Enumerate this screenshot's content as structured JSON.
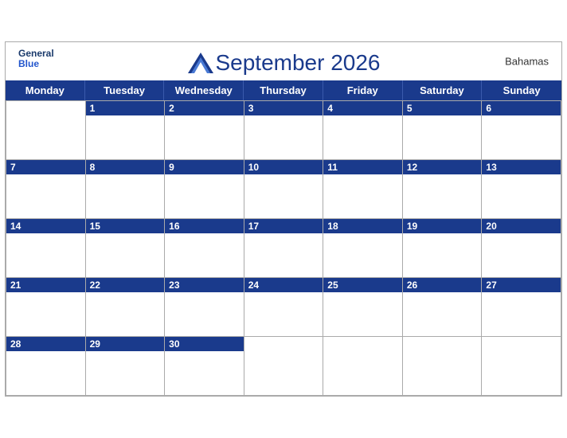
{
  "calendar": {
    "title": "September 2026",
    "country": "Bahamas",
    "logo": {
      "line1": "General",
      "line2": "Blue"
    },
    "days_of_week": [
      "Monday",
      "Tuesday",
      "Wednesday",
      "Thursday",
      "Friday",
      "Saturday",
      "Sunday"
    ],
    "weeks": [
      [
        null,
        1,
        2,
        3,
        4,
        5,
        6
      ],
      [
        7,
        8,
        9,
        10,
        11,
        12,
        13
      ],
      [
        14,
        15,
        16,
        17,
        18,
        19,
        20
      ],
      [
        21,
        22,
        23,
        24,
        25,
        26,
        27
      ],
      [
        28,
        29,
        30,
        null,
        null,
        null,
        null
      ]
    ]
  }
}
